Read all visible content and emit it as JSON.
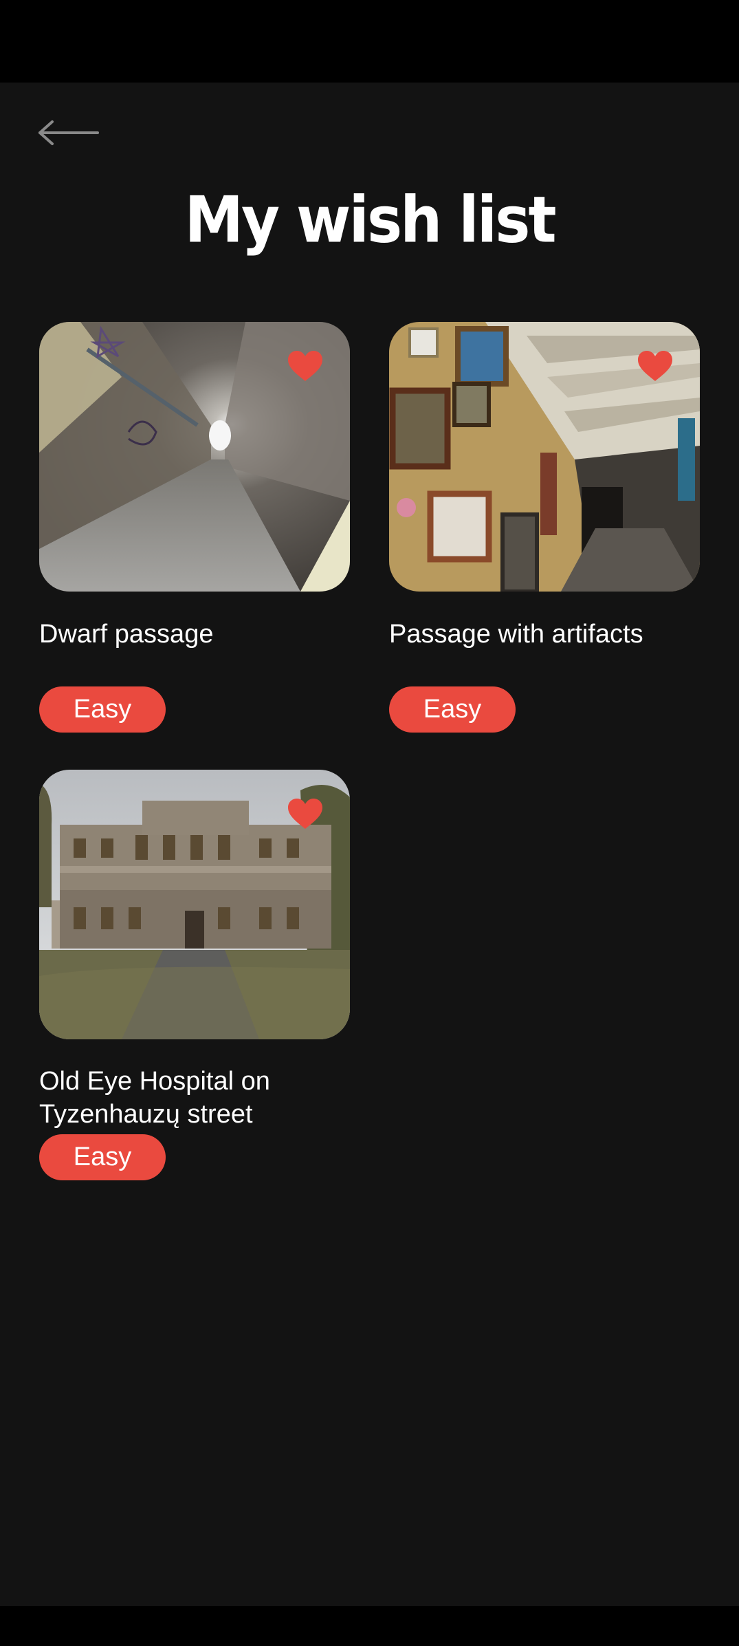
{
  "page": {
    "title": "My wish list"
  },
  "icons": {
    "back": "arrow-left-icon",
    "favorite": "heart-filled-icon"
  },
  "colors": {
    "background": "#131313",
    "accent": "#ea4a3f",
    "text": "#ffffff"
  },
  "places": [
    {
      "title": "Dwarf passage",
      "difficulty": "Easy",
      "favorite": true
    },
    {
      "title": "Passage with artifacts",
      "difficulty": "Easy",
      "favorite": true
    },
    {
      "title": "Old Eye Hospital on Tyzenhauzų street",
      "difficulty": "Easy",
      "favorite": true
    }
  ]
}
